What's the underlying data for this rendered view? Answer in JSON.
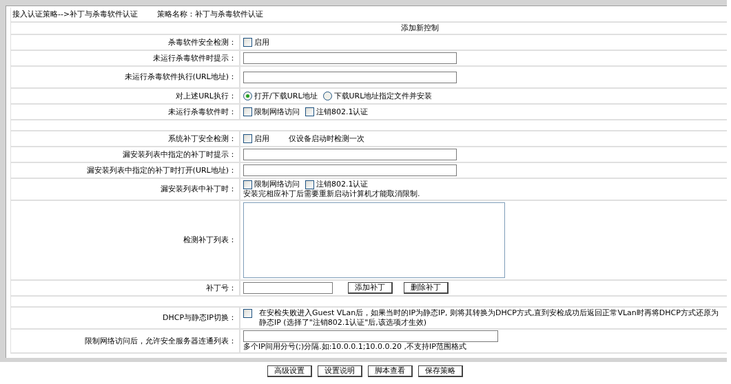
{
  "header": {
    "breadcrumb": "接入认证策略-->补丁与杀毒软件认证",
    "policy_name": "策略名称：补丁与杀毒软件认证"
  },
  "section_title": "添加新控制",
  "rows": [
    {
      "kind": "checkbox",
      "label": "杀毒软件安全检测：",
      "options": [
        {
          "label": "启用",
          "checked": false
        }
      ]
    },
    {
      "kind": "text",
      "label": "未运行杀毒软件时提示："
    },
    {
      "kind": "text",
      "label": "未运行杀毒软件执行(URL地址)："
    },
    {
      "kind": "radio",
      "label": "对上述URL执行：",
      "options": [
        {
          "label": "打开/下载URL地址",
          "selected": true
        },
        {
          "label": "下载URL地址指定文件并安装",
          "selected": false
        }
      ]
    },
    {
      "kind": "checkbox",
      "label": "未运行杀毒软件时：",
      "options": [
        {
          "label": "限制网络访问",
          "checked": false
        },
        {
          "label": "注销802.1认证",
          "checked": false
        }
      ]
    },
    {
      "kind": "blank"
    },
    {
      "kind": "checkbox",
      "label": "系统补丁安全检测：",
      "options": [
        {
          "label": "启用",
          "checked": false
        }
      ],
      "note": "仅设备启动时检测一次"
    },
    {
      "kind": "text",
      "label": "漏安装列表中指定的补丁时提示："
    },
    {
      "kind": "text",
      "label": "漏安装列表中指定的补丁时打开(URL地址)："
    },
    {
      "kind": "checkbox",
      "label": "漏安装列表中补丁时：",
      "options": [
        {
          "label": "限制网络访问",
          "checked": false
        },
        {
          "label": "注销802.1认证",
          "checked": false
        }
      ],
      "hint": "安装完相应补丁后需要重新启动计算机才能取消限制."
    },
    {
      "kind": "textarea",
      "label": "检测补丁列表："
    },
    {
      "kind": "patch",
      "label": "补丁号：",
      "buttons": [
        "添加补丁",
        "删除补丁"
      ]
    },
    {
      "kind": "blank"
    },
    {
      "kind": "checktext",
      "label": "DHCP与静态IP切换：",
      "checked": false,
      "text": "在安检失败进入Guest VLan后，如果当时的IP为静态IP, 则将其转换为DHCP方式,直到安检成功后返回正常VLan时再将DHCP方式还原为静态IP (选择了\"注销802.1认证\"后,该选项才生效)"
    },
    {
      "kind": "list",
      "label": "限制网络访问后，允许安全服务器连通列表：",
      "hint": "多个IP间用分号(;)分隔.如:10.0.0.1;10.0.0.20 ,不支持IP范围格式"
    }
  ],
  "buttons": [
    "高级设置",
    "设置说明",
    "脚本查看",
    "保存策略"
  ]
}
